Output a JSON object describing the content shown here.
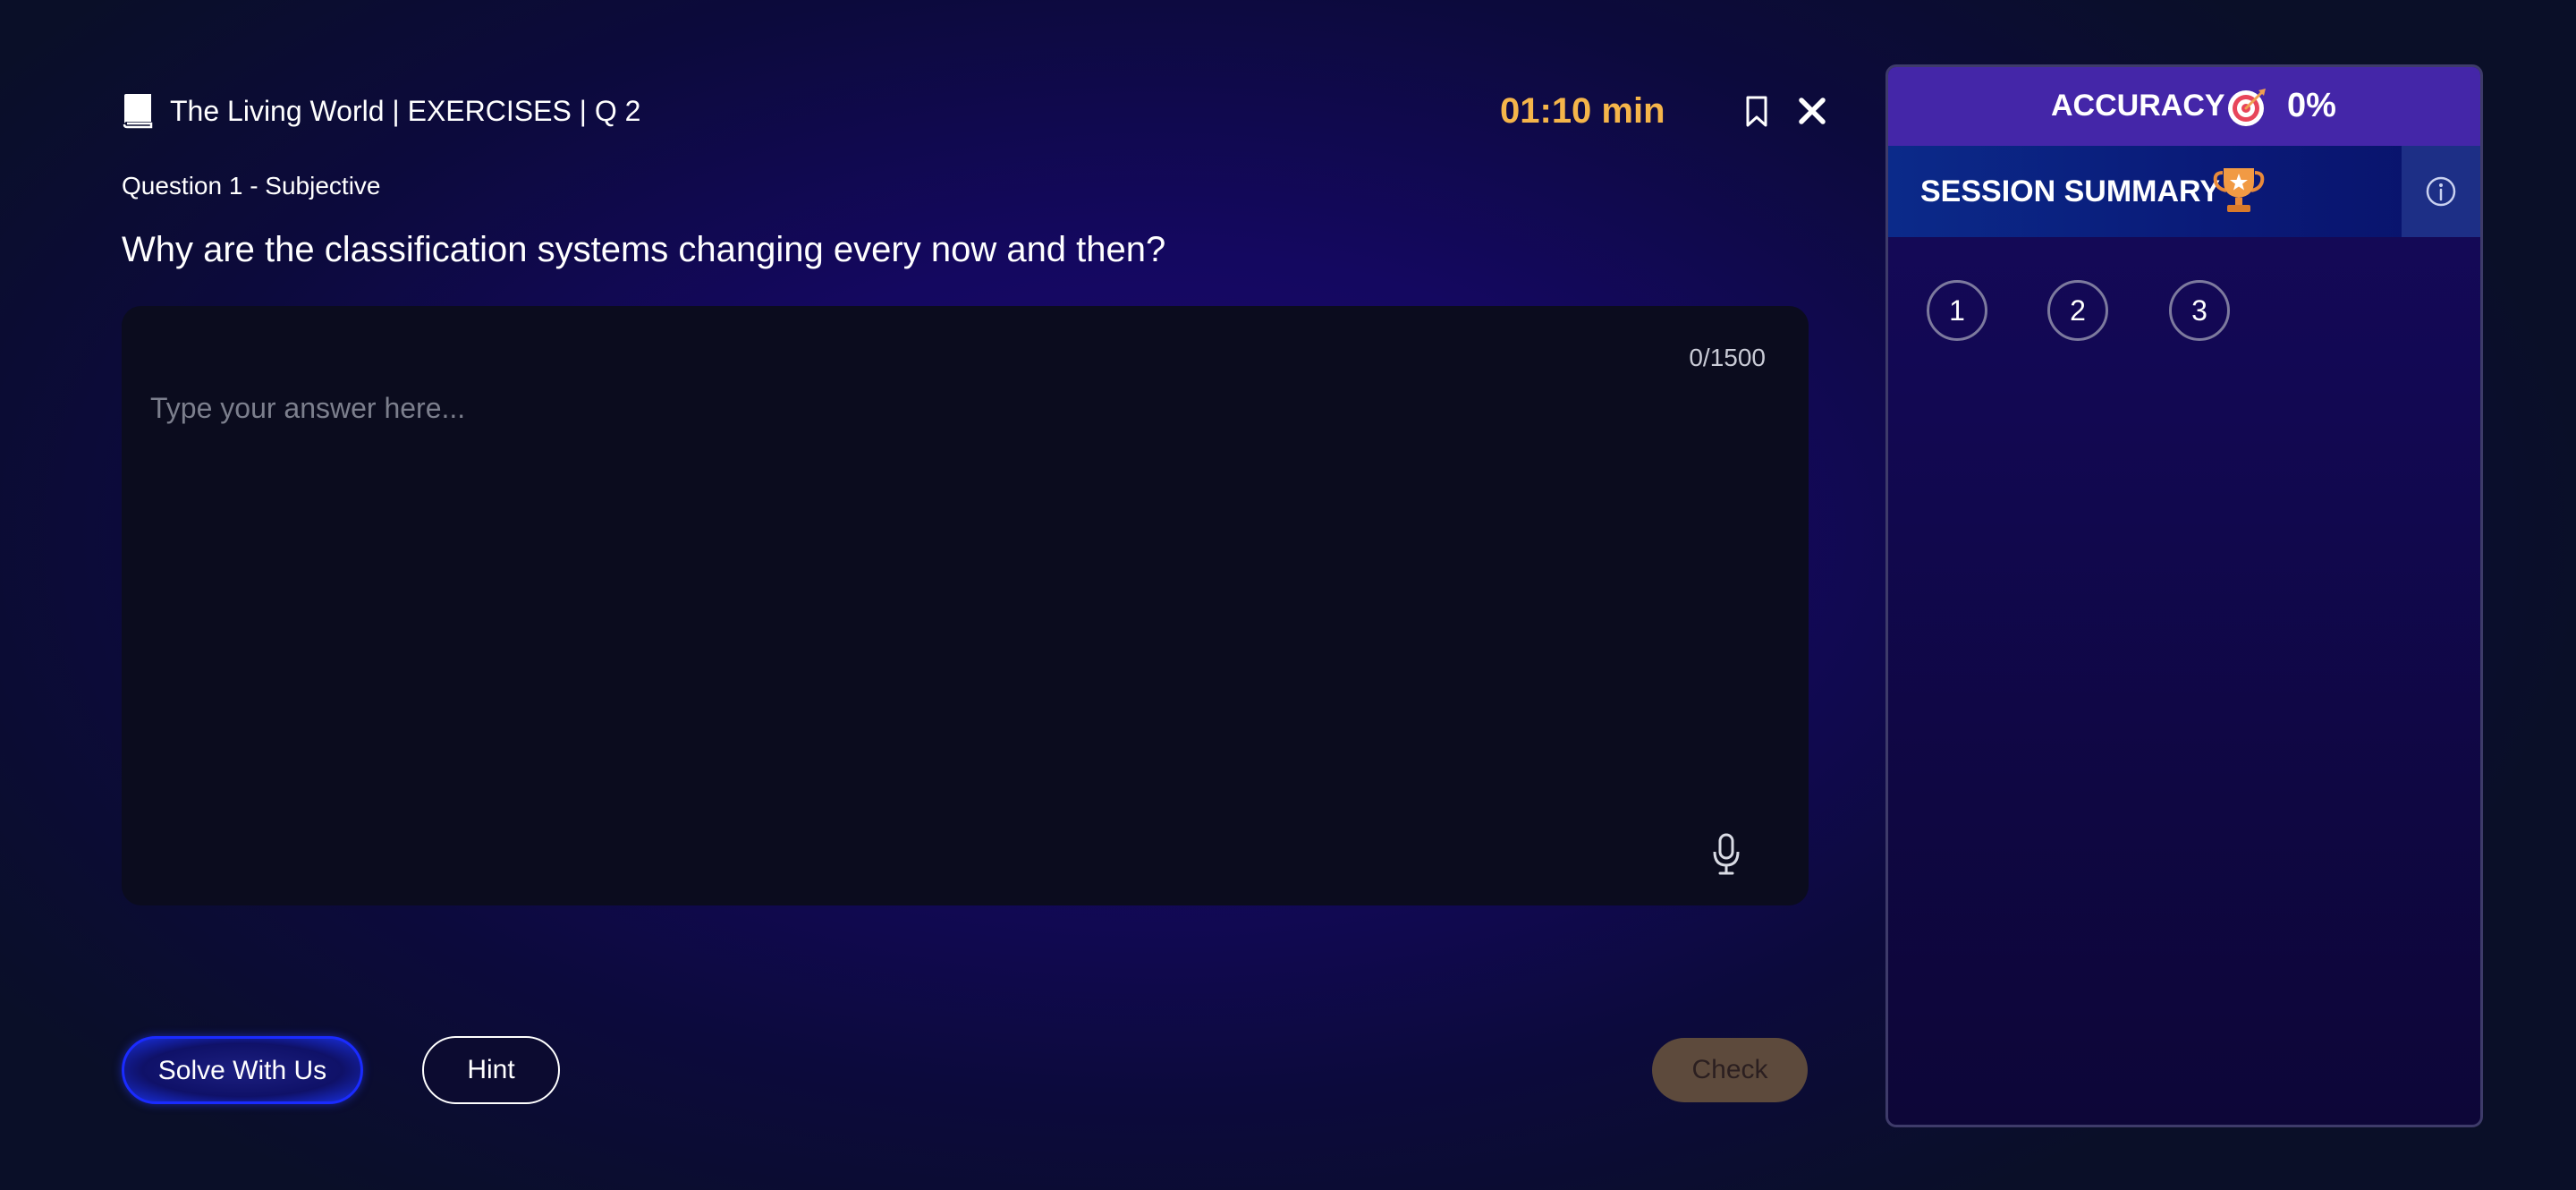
{
  "header": {
    "breadcrumb": "The Living World | EXERCISES | Q 2",
    "timer": "01:10 min",
    "icons": [
      "book-icon",
      "bookmark-icon",
      "close-icon"
    ]
  },
  "question": {
    "meta": "Question 1 - Subjective",
    "text": "Why are the classification systems changing every now and then?"
  },
  "answer": {
    "placeholder": "Type your answer here...",
    "value": "",
    "char_count": "0/1500",
    "mic_icon": "microphone-icon"
  },
  "actions": {
    "solve_label": "Solve With Us",
    "hint_label": "Hint",
    "check_label": "Check"
  },
  "panel": {
    "accuracy_label": "ACCURACY",
    "accuracy_value": "0%",
    "accuracy_icon": "target-icon",
    "summary_label": "SESSION SUMMARY",
    "summary_icon": "trophy-icon",
    "info_icon": "info-icon",
    "questions": [
      "1",
      "2",
      "3"
    ]
  },
  "colors": {
    "timer": "#f5b54a",
    "accuracy_bar": "#4426a8",
    "summary_bar": "#0b2a8a",
    "solve_border": "#1a2bff",
    "check_bg": "#5d4a3c"
  }
}
